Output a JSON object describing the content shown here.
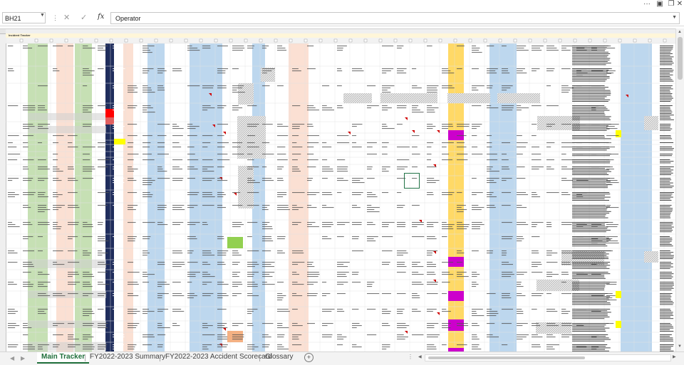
{
  "window": {
    "icons": [
      "more-options-icon",
      "ribbon-display-icon",
      "restore-icon",
      "close-icon"
    ]
  },
  "formula_bar": {
    "name_box": "BH21",
    "fx_label": "fx",
    "content": "Operator"
  },
  "sheet": {
    "title": "Incident Tracker",
    "colors": {
      "green": "#c6e0b4",
      "peach": "#fbe0d3",
      "blue": "#bdd7ee",
      "navy": "#1f2d5c",
      "orange": "#ffd966",
      "magenta": "#cc00cc",
      "red": "#ff0000",
      "yellow": "#ffff00",
      "hatch": "#d9d9d9",
      "grid": "#e2e2e2"
    }
  },
  "tabs": [
    {
      "label": "Main Tracker",
      "active": true
    },
    {
      "label": "FY2022-2023 Summary",
      "active": false
    },
    {
      "label": "FY2022-2023 Accident Scorecard",
      "active": false
    },
    {
      "label": "Glossary",
      "active": false
    }
  ]
}
